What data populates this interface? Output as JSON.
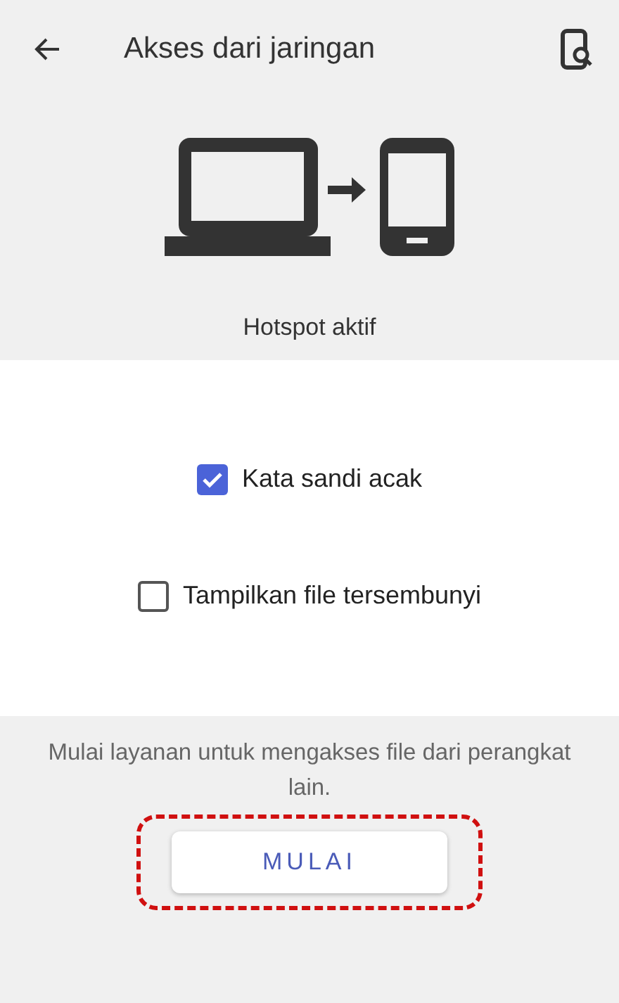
{
  "header": {
    "title": "Akses dari jaringan"
  },
  "status": {
    "label": "Hotspot aktif"
  },
  "options": [
    {
      "label": "Kata sandi acak",
      "checked": true
    },
    {
      "label": "Tampilkan file tersembunyi",
      "checked": false
    }
  ],
  "footer": {
    "description": "Mulai layanan untuk mengakses file dari perangkat lain.",
    "button": "MULAI",
    "highlighted": true
  }
}
